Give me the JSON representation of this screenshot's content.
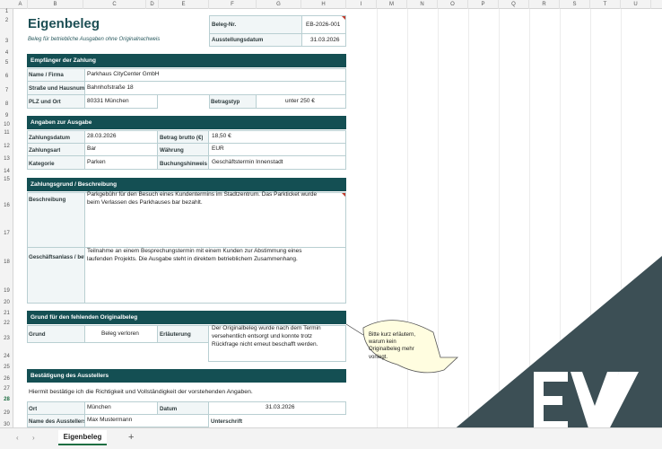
{
  "columns": [
    "A",
    "B",
    "C",
    "D",
    "E",
    "F",
    "G",
    "H",
    "I",
    "M",
    "N",
    "O",
    "P",
    "Q",
    "R",
    "S",
    "T",
    "U"
  ],
  "rows": [
    "1",
    "2",
    "3",
    "4",
    "5",
    "6",
    "7",
    "8",
    "9",
    "10",
    "11",
    "12",
    "13",
    "14",
    "15",
    "16",
    "17",
    "18",
    "19",
    "20",
    "21",
    "22",
    "23",
    "24",
    "25",
    "26",
    "27",
    "28",
    "29",
    "30"
  ],
  "header": {
    "title": "Eigenbeleg",
    "subtitle": "Beleg für betriebliche Ausgaben ohne Originalnachweis",
    "nr_label": "Beleg-Nr.",
    "nr_value": "EB-2026-001",
    "date_label": "Ausstellungsdatum",
    "date_value": "31.03.2026"
  },
  "recipient": {
    "heading": "Empfänger der Zahlung",
    "name_label": "Name / Firma",
    "name_value": "Parkhaus CityCenter GmbH",
    "street_label": "Straße und Hausnummer",
    "street_value": "Bahnhofstraße 18",
    "plz_label": "PLZ und Ort",
    "plz_value": "80331 München",
    "type_label": "Betragstyp",
    "type_value": "unter 250 €"
  },
  "expense": {
    "heading": "Angaben zur Ausgabe",
    "date_label": "Zahlungsdatum",
    "date_value": "28.03.2026",
    "amount_label": "Betrag brutto (€)",
    "amount_value": "18,50 €",
    "method_label": "Zahlungsart",
    "method_value": "Bar",
    "currency_label": "Währung",
    "currency_value": "EUR",
    "category_label": "Kategorie",
    "category_value": "Parken",
    "note_label": "Buchungshinweis",
    "note_value": "Geschäftstermin Innenstadt"
  },
  "reason": {
    "heading": "Zahlungsgrund / Beschreibung",
    "desc_label": "Beschreibung",
    "desc_line1": "Parkgebühr für den Besuch eines Kundentermins im Stadtzentrum. Das Parkticket wurde",
    "desc_line2": "beim Verlassen des Parkhauses bar bezahlt.",
    "occasion_label": "Geschäftsanlass / betrieblicher Zweck",
    "occasion_line1": "Teilnahme an einem Besprechungstermin mit einem Kunden zur Abstimmung eines",
    "occasion_line2": "laufenden Projekts. Die Ausgabe steht in direktem betrieblichem Zusammenhang."
  },
  "missing": {
    "heading": "Grund für den fehlenden Originalbeleg",
    "reason_label": "Grund",
    "reason_value": "Beleg verloren",
    "explain_label": "Erläuterung",
    "explain_line1": "Der Originalbeleg wurde nach dem Termin",
    "explain_line2": "versehentlich entsorgt und konnte trotz",
    "explain_line3": "Rückfrage nicht erneut beschafft werden."
  },
  "comment": {
    "line1": "Bitte kurz erläutern,",
    "line2": "warum kein",
    "line3": "Originalbeleg mehr",
    "line4": "vorliegt."
  },
  "confirm": {
    "heading": "Bestätigung des Ausstellers",
    "statement": "Hiermit bestätige ich die Richtigkeit und Vollständigkeit der vorstehenden Angaben.",
    "place_label": "Ort",
    "place_value": "München",
    "date_label": "Datum",
    "date_value": "31.03.2026",
    "issuer_label": "Name des Ausstellers",
    "issuer_value": "Max Mustermann",
    "signature_label": "Unterschrift"
  },
  "sheet": {
    "tab": "Eigenbeleg",
    "add": "+",
    "prev": "‹",
    "next": "›"
  },
  "colors": {
    "band": "#144f53",
    "accent": "#1d4f55",
    "corner": "#3c4f55",
    "note": "#fffde0"
  },
  "logo_text": "EW"
}
